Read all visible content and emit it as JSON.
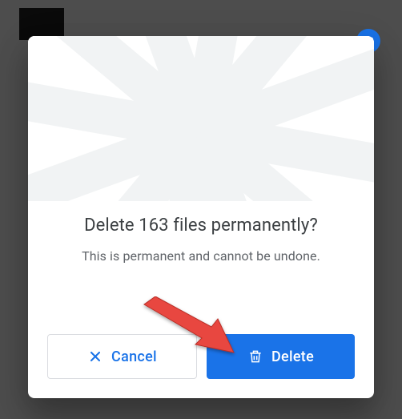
{
  "dialog": {
    "title": "Delete 163 files permanently?",
    "message": "This is permanent and cannot be undone.",
    "cancel_label": "Cancel",
    "delete_label": "Delete"
  },
  "colors": {
    "primary": "#1a73e8",
    "text": "#3c4043",
    "secondary_text": "#5f6368",
    "border": "#dadce0"
  }
}
